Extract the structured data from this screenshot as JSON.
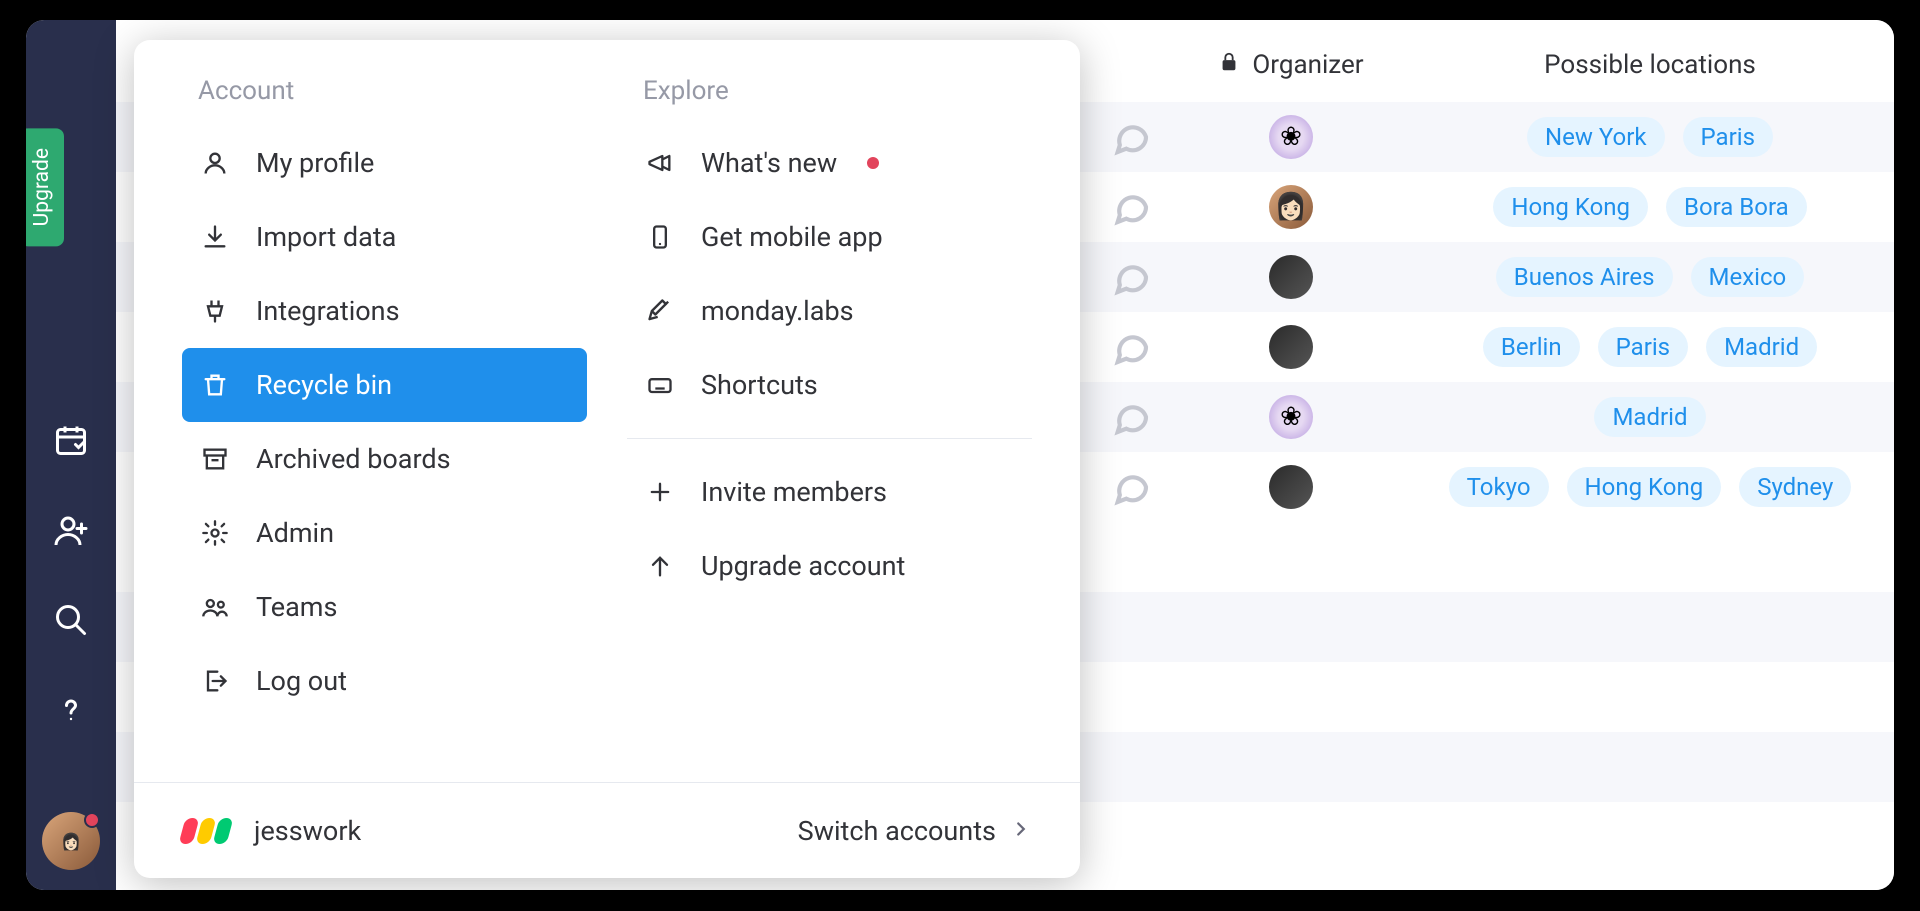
{
  "sidebar": {
    "upgrade_label": "Upgrade"
  },
  "dropdown": {
    "account_header": "Account",
    "explore_header": "Explore",
    "account_items": {
      "profile": "My profile",
      "import": "Import data",
      "integrations": "Integrations",
      "recycle": "Recycle bin",
      "archived": "Archived boards",
      "admin": "Admin",
      "teams": "Teams",
      "logout": "Log out"
    },
    "explore_items": {
      "whatsnew": "What's new",
      "mobile": "Get mobile app",
      "labs": "monday.labs",
      "shortcuts": "Shortcuts",
      "invite": "Invite members",
      "upgrade": "Upgrade account"
    },
    "footer": {
      "workspace": "jesswork",
      "switch": "Switch accounts"
    }
  },
  "table": {
    "headers": {
      "organizer": "Organizer",
      "locations": "Possible locations"
    },
    "rows": [
      {
        "organizer": "flower",
        "locations": [
          "New York",
          "Paris"
        ]
      },
      {
        "organizer": "person1",
        "locations": [
          "Hong Kong",
          "Bora Bora"
        ]
      },
      {
        "organizer": "person2",
        "locations": [
          "Buenos Aires",
          "Mexico"
        ]
      },
      {
        "organizer": "person2",
        "locations": [
          "Berlin",
          "Paris",
          "Madrid"
        ]
      },
      {
        "organizer": "flower",
        "locations": [
          "Madrid"
        ]
      },
      {
        "organizer": "person2",
        "locations": [
          "Tokyo",
          "Hong Kong",
          "Sydney"
        ]
      }
    ]
  }
}
